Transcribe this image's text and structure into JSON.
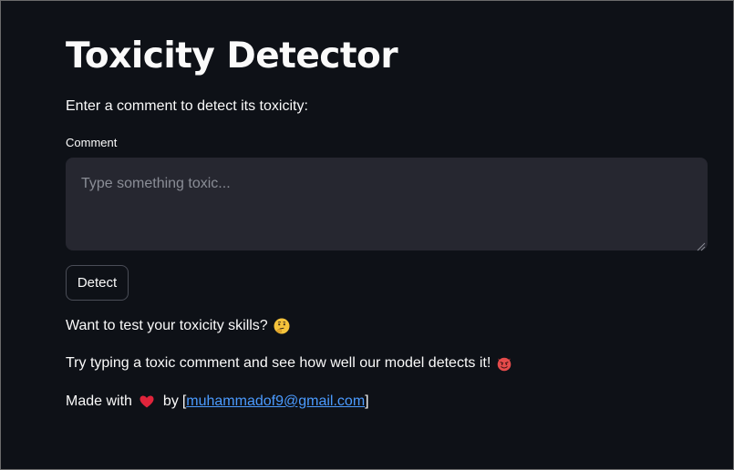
{
  "page": {
    "title": "Toxicity Detector",
    "subtitle": "Enter a comment to detect its toxicity:"
  },
  "comment_field": {
    "label": "Comment",
    "placeholder": "Type something toxic...",
    "value": ""
  },
  "detect_button": {
    "label": "Detect"
  },
  "messages": {
    "challenge": "Want to test your toxicity skills?",
    "challenge_icon": "thinking-face-icon",
    "try_text": "Try typing a toxic comment and see how well our model detects it!",
    "try_icon": "devil-face-icon",
    "made_with": "Made with",
    "made_with_icon": "heart-icon",
    "by": "by",
    "bracket_open": "[",
    "email": "muhammadof9@gmail.com",
    "bracket_close": "]"
  },
  "colors": {
    "background": "#0e1117",
    "input_background": "#262730",
    "text": "#fafafa",
    "link": "#4b9bff",
    "heart": "#e0243b",
    "devil": "#e54b4b"
  }
}
